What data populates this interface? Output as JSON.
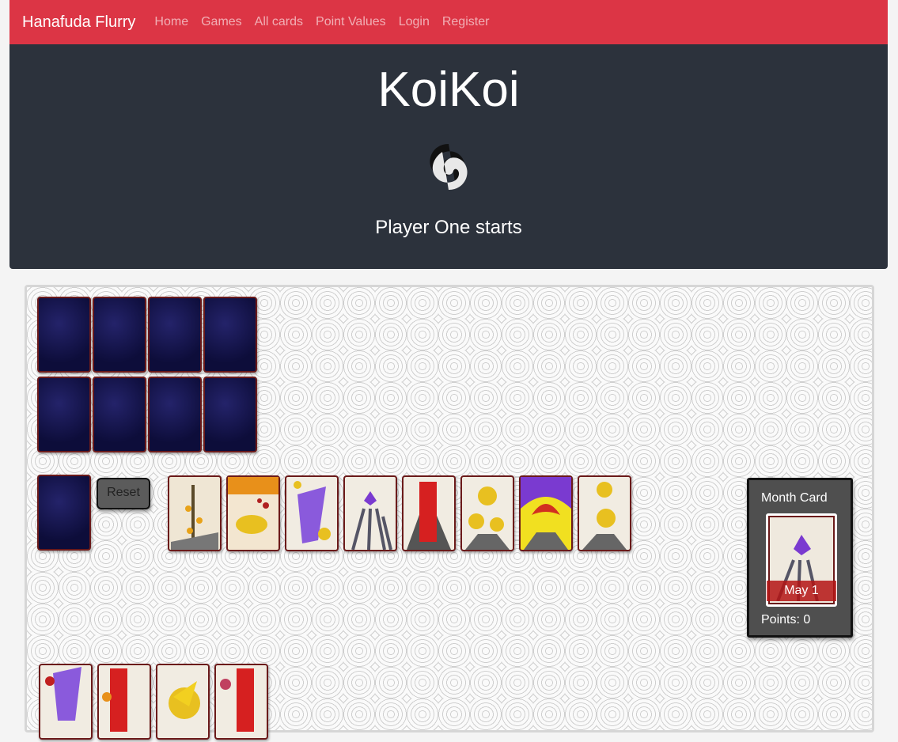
{
  "nav": {
    "brand": "Hanafuda Flurry",
    "links": [
      "Home",
      "Games",
      "All cards",
      "Point Values",
      "Login",
      "Register"
    ]
  },
  "hero": {
    "title": "KoiKoi",
    "status": "Player One starts"
  },
  "board": {
    "reset_label": "Reset",
    "month_card": {
      "title": "Month Card",
      "card_label": "May 1",
      "points_text": "Points: 0"
    }
  },
  "colors": {
    "navbar": "#dc3545",
    "hero": "#2c323c",
    "card_back": "#0d0d3a",
    "card_border": "#6b1a1a"
  }
}
